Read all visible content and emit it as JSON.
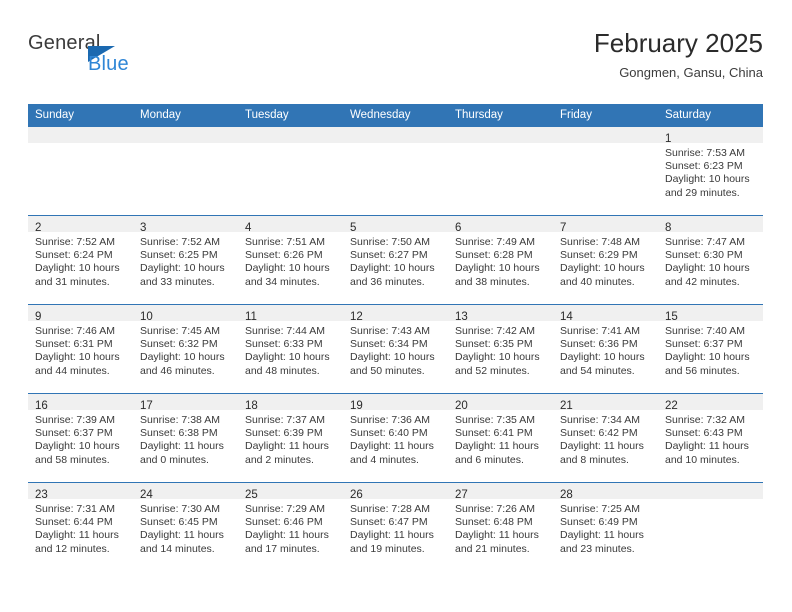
{
  "brand": {
    "name_part1": "General",
    "name_part2": "Blue",
    "triangle_color": "#1b69b0",
    "blue_color": "#2f86d6"
  },
  "header": {
    "title": "February 2025",
    "subtitle": "Gongmen, Gansu, China"
  },
  "theme": {
    "header_blue": "#3175b5",
    "day_band_gray": "#f0f0f0",
    "text_color": "#3a3a3a"
  },
  "weekday_headers": [
    "Sunday",
    "Monday",
    "Tuesday",
    "Wednesday",
    "Thursday",
    "Friday",
    "Saturday"
  ],
  "weeks": [
    [
      {
        "empty": true
      },
      {
        "empty": true
      },
      {
        "empty": true
      },
      {
        "empty": true
      },
      {
        "empty": true
      },
      {
        "empty": true
      },
      {
        "day": "1",
        "sunrise": "Sunrise: 7:53 AM",
        "sunset": "Sunset: 6:23 PM",
        "daylight": "Daylight: 10 hours and 29 minutes."
      }
    ],
    [
      {
        "day": "2",
        "sunrise": "Sunrise: 7:52 AM",
        "sunset": "Sunset: 6:24 PM",
        "daylight": "Daylight: 10 hours and 31 minutes."
      },
      {
        "day": "3",
        "sunrise": "Sunrise: 7:52 AM",
        "sunset": "Sunset: 6:25 PM",
        "daylight": "Daylight: 10 hours and 33 minutes."
      },
      {
        "day": "4",
        "sunrise": "Sunrise: 7:51 AM",
        "sunset": "Sunset: 6:26 PM",
        "daylight": "Daylight: 10 hours and 34 minutes."
      },
      {
        "day": "5",
        "sunrise": "Sunrise: 7:50 AM",
        "sunset": "Sunset: 6:27 PM",
        "daylight": "Daylight: 10 hours and 36 minutes."
      },
      {
        "day": "6",
        "sunrise": "Sunrise: 7:49 AM",
        "sunset": "Sunset: 6:28 PM",
        "daylight": "Daylight: 10 hours and 38 minutes."
      },
      {
        "day": "7",
        "sunrise": "Sunrise: 7:48 AM",
        "sunset": "Sunset: 6:29 PM",
        "daylight": "Daylight: 10 hours and 40 minutes."
      },
      {
        "day": "8",
        "sunrise": "Sunrise: 7:47 AM",
        "sunset": "Sunset: 6:30 PM",
        "daylight": "Daylight: 10 hours and 42 minutes."
      }
    ],
    [
      {
        "day": "9",
        "sunrise": "Sunrise: 7:46 AM",
        "sunset": "Sunset: 6:31 PM",
        "daylight": "Daylight: 10 hours and 44 minutes."
      },
      {
        "day": "10",
        "sunrise": "Sunrise: 7:45 AM",
        "sunset": "Sunset: 6:32 PM",
        "daylight": "Daylight: 10 hours and 46 minutes."
      },
      {
        "day": "11",
        "sunrise": "Sunrise: 7:44 AM",
        "sunset": "Sunset: 6:33 PM",
        "daylight": "Daylight: 10 hours and 48 minutes."
      },
      {
        "day": "12",
        "sunrise": "Sunrise: 7:43 AM",
        "sunset": "Sunset: 6:34 PM",
        "daylight": "Daylight: 10 hours and 50 minutes."
      },
      {
        "day": "13",
        "sunrise": "Sunrise: 7:42 AM",
        "sunset": "Sunset: 6:35 PM",
        "daylight": "Daylight: 10 hours and 52 minutes."
      },
      {
        "day": "14",
        "sunrise": "Sunrise: 7:41 AM",
        "sunset": "Sunset: 6:36 PM",
        "daylight": "Daylight: 10 hours and 54 minutes."
      },
      {
        "day": "15",
        "sunrise": "Sunrise: 7:40 AM",
        "sunset": "Sunset: 6:37 PM",
        "daylight": "Daylight: 10 hours and 56 minutes."
      }
    ],
    [
      {
        "day": "16",
        "sunrise": "Sunrise: 7:39 AM",
        "sunset": "Sunset: 6:37 PM",
        "daylight": "Daylight: 10 hours and 58 minutes."
      },
      {
        "day": "17",
        "sunrise": "Sunrise: 7:38 AM",
        "sunset": "Sunset: 6:38 PM",
        "daylight": "Daylight: 11 hours and 0 minutes."
      },
      {
        "day": "18",
        "sunrise": "Sunrise: 7:37 AM",
        "sunset": "Sunset: 6:39 PM",
        "daylight": "Daylight: 11 hours and 2 minutes."
      },
      {
        "day": "19",
        "sunrise": "Sunrise: 7:36 AM",
        "sunset": "Sunset: 6:40 PM",
        "daylight": "Daylight: 11 hours and 4 minutes."
      },
      {
        "day": "20",
        "sunrise": "Sunrise: 7:35 AM",
        "sunset": "Sunset: 6:41 PM",
        "daylight": "Daylight: 11 hours and 6 minutes."
      },
      {
        "day": "21",
        "sunrise": "Sunrise: 7:34 AM",
        "sunset": "Sunset: 6:42 PM",
        "daylight": "Daylight: 11 hours and 8 minutes."
      },
      {
        "day": "22",
        "sunrise": "Sunrise: 7:32 AM",
        "sunset": "Sunset: 6:43 PM",
        "daylight": "Daylight: 11 hours and 10 minutes."
      }
    ],
    [
      {
        "day": "23",
        "sunrise": "Sunrise: 7:31 AM",
        "sunset": "Sunset: 6:44 PM",
        "daylight": "Daylight: 11 hours and 12 minutes."
      },
      {
        "day": "24",
        "sunrise": "Sunrise: 7:30 AM",
        "sunset": "Sunset: 6:45 PM",
        "daylight": "Daylight: 11 hours and 14 minutes."
      },
      {
        "day": "25",
        "sunrise": "Sunrise: 7:29 AM",
        "sunset": "Sunset: 6:46 PM",
        "daylight": "Daylight: 11 hours and 17 minutes."
      },
      {
        "day": "26",
        "sunrise": "Sunrise: 7:28 AM",
        "sunset": "Sunset: 6:47 PM",
        "daylight": "Daylight: 11 hours and 19 minutes."
      },
      {
        "day": "27",
        "sunrise": "Sunrise: 7:26 AM",
        "sunset": "Sunset: 6:48 PM",
        "daylight": "Daylight: 11 hours and 21 minutes."
      },
      {
        "day": "28",
        "sunrise": "Sunrise: 7:25 AM",
        "sunset": "Sunset: 6:49 PM",
        "daylight": "Daylight: 11 hours and 23 minutes."
      },
      {
        "empty": true
      }
    ]
  ]
}
